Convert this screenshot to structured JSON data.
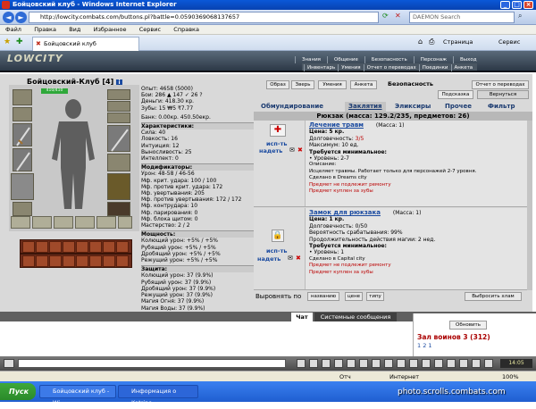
{
  "window": {
    "title": "Бойцовский клуб - Windows Internet Explorer",
    "address": "http://lowcity.combats.com/buttons.pl?battle=0.0590369068137657",
    "search_placeholder": "DAEMON Search"
  },
  "menu": [
    "Файл",
    "Правка",
    "Вид",
    "Избранное",
    "Сервис",
    "Справка"
  ],
  "browser_tab": "Бойцовский клуб",
  "toolbar": {
    "page": "Страница",
    "tools": "Сервис"
  },
  "game": {
    "logo": "LOWCITY",
    "top_tabs": [
      "Знания",
      "Общение",
      "Безопасность",
      "Персонаж",
      "Выход"
    ],
    "sub_tabs": [
      "Инвентарь",
      "Умения",
      "Отчет о переводах",
      "Поединки",
      "Анкета"
    ]
  },
  "character": {
    "name": "Бойцовский-Клуб",
    "level": "[4]",
    "hp": "410/410"
  },
  "stats": {
    "lines": [
      "Опыт: 4658 (5000)",
      "Бои: 286 ▲ 147 ✓ 26 ?",
      "Деньги: 418.30 кр.",
      "Зубы: 15 ₩5 ₹7.77"
    ],
    "bank": "Банк: 0.00кр. 450.50екр.",
    "characteristics_title": "Характеристики:",
    "characteristics": [
      "Сила: 40",
      "Ловкость: 16",
      "Интуиция: 12",
      "Выносливость: 25",
      "Интеллект: 0"
    ],
    "modifiers_title": "Модификаторы:",
    "modifiers": [
      "Урон: 48-58 / 46-56",
      "Мф. крит. удара: 100 / 100",
      "Мф. против крит. удара: 172",
      "Мф. увертывания: 205",
      "Мф. против увертывания: 172 / 172",
      "Мф. контрудара: 10",
      "Мф. парирования: 0",
      "Мф. блока щитом: 0",
      "Мастерство: 2 / 2"
    ],
    "power_title": "Мощность:",
    "power": [
      "Колющий урон: +5% / +5%",
      "Рубящий урон: +5% / +5%",
      "Дробящий урон: +5% / +5%",
      "Режущий урон: +5% / +5%"
    ],
    "defense_title": "Защита:",
    "defense": [
      "Колющий урон: 37 (9.9%)",
      "Рубящий урон: 37 (9.9%)",
      "Дробящий урон: 37 (9.9%)",
      "Режущий урон: 37 (9.9%)",
      "Магия Огня: 37 (9.9%)",
      "Магия Воды: 37 (9.9%)"
    ]
  },
  "panel": {
    "top_buttons": [
      "Образ",
      "Зверь",
      "Умения",
      "Анкета"
    ],
    "security": "Безопасность",
    "transfer_report": "Отчет о переводах",
    "hint": "Подсказка",
    "back": "Вернуться",
    "categories": [
      "Обмундирование",
      "Заклятия",
      "Эликсиры",
      "Прочее",
      "Фильтр"
    ],
    "bag_title": "Рюкзак (масса: 129.2/235, предметов: 26)",
    "use_label": "исп-ть",
    "wear_label": "надеть",
    "items": [
      {
        "name": "Лечение травм",
        "mass": "(Масса: 1)",
        "price": "Цена: 5 кр.",
        "durability_label": "Долговечность: ",
        "durability": "3/5",
        "extra1": "Максимум: 10 ед.",
        "requirements": "Требуется минимальное:",
        "req1": "• Уровень: 2-7",
        "desc_label": "Описание:",
        "desc": "Исцеляет травмы. Работает только для персонажей 2-7 уровня.",
        "made": "Сделано в Dreams city",
        "warn1": "Предмет не подлежит ремонту",
        "warn2": "Предмет куплен за зубы"
      },
      {
        "name": "Замок для рюкзака",
        "mass": "(Масса: 1)",
        "price": "Цена: 1 кр.",
        "durability_label": "Долговечность: ",
        "durability": "0/50",
        "extra1": "Вероятность срабатывания: 99%",
        "extra2": "Продолжительность действия магии: 2 нед.",
        "requirements": "Требуется минимальное:",
        "req1": "• Уровень: 1",
        "made": "Сделано в Capital city",
        "warn1": "Предмет не подлежит ремонту",
        "warn2": "Предмет куплен за зубы"
      }
    ],
    "sort_label": "Выровнять по",
    "sort_options": [
      "названию",
      "цене",
      "типу"
    ],
    "throw_junk": "Выбросить хлам"
  },
  "chat": {
    "tab_chat": "Чат",
    "tab_system": "Системные сообщения",
    "refresh": "Обновить",
    "room": "Зал воинов 3 (312)",
    "pages": "1 2 1"
  },
  "clock": "14:05",
  "status": {
    "ready": "Отч",
    "zone": "Интернет",
    "zoom": "100%"
  },
  "taskbar": {
    "start": "Пуск",
    "tasks": [
      "Бойцовский клуб - Wi...",
      "Информация о Katrino -..."
    ],
    "watermark": "photo.scrolls.combats.com"
  }
}
